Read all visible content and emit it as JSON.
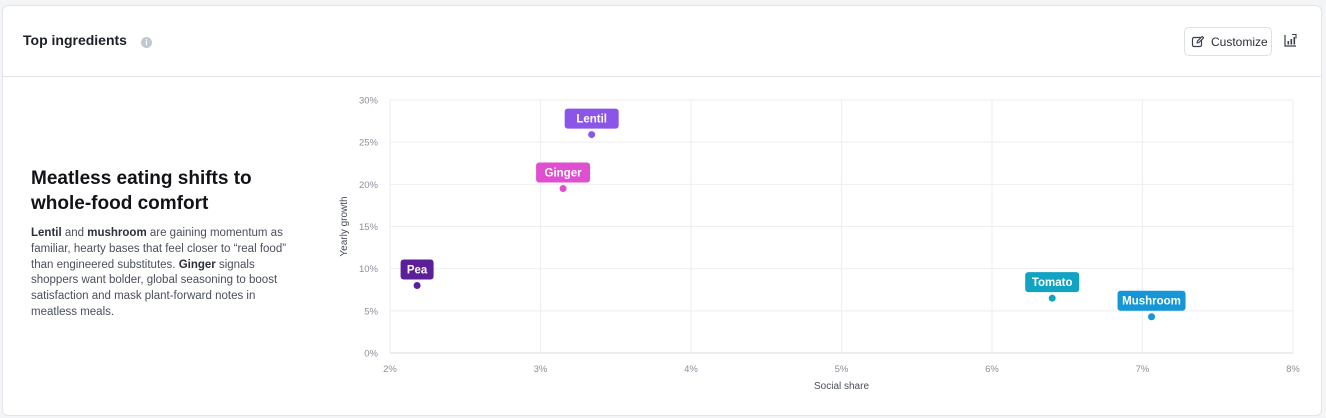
{
  "header": {
    "title": "Top ingredients",
    "info_icon": "info-icon",
    "customize_label": "Customize",
    "customize_icon": "edit-icon",
    "export_icon": "chart-export-icon"
  },
  "insight": {
    "headline": "Meatless eating shifts to whole-food comfort",
    "body": [
      {
        "text": "Lentil",
        "bold": true
      },
      {
        "text": " and ",
        "bold": false
      },
      {
        "text": "mushroom",
        "bold": true
      },
      {
        "text": " are gaining momentum as familiar, hearty bases that feel closer to “real food” than engineered substitutes. ",
        "bold": false
      },
      {
        "text": "Ginger",
        "bold": true
      },
      {
        "text": " signals shoppers want bolder, global seasoning to boost satisfaction and mask plant-forward notes in meatless meals.",
        "bold": false
      }
    ]
  },
  "chart_data": {
    "type": "scatter",
    "xlabel": "Social share",
    "ylabel": "Yearly growth",
    "xlim": [
      2,
      8
    ],
    "ylim": [
      0,
      30
    ],
    "x_ticks": [
      "2%",
      "3%",
      "4%",
      "5%",
      "6%",
      "7%",
      "8%"
    ],
    "y_ticks": [
      "0%",
      "5%",
      "10%",
      "15%",
      "20%",
      "25%",
      "30%"
    ],
    "grid": true,
    "points": [
      {
        "label": "Lentil",
        "x": 3.34,
        "y": 25.9,
        "color": "#8b55e8"
      },
      {
        "label": "Ginger",
        "x": 3.15,
        "y": 19.5,
        "color": "#e04fcf"
      },
      {
        "label": "Pea",
        "x": 2.18,
        "y": 8.0,
        "color": "#5b1f9a"
      },
      {
        "label": "Tomato",
        "x": 6.4,
        "y": 6.5,
        "color": "#12a3c2"
      },
      {
        "label": "Mushroom",
        "x": 7.06,
        "y": 4.3,
        "color": "#1596d6"
      }
    ]
  }
}
